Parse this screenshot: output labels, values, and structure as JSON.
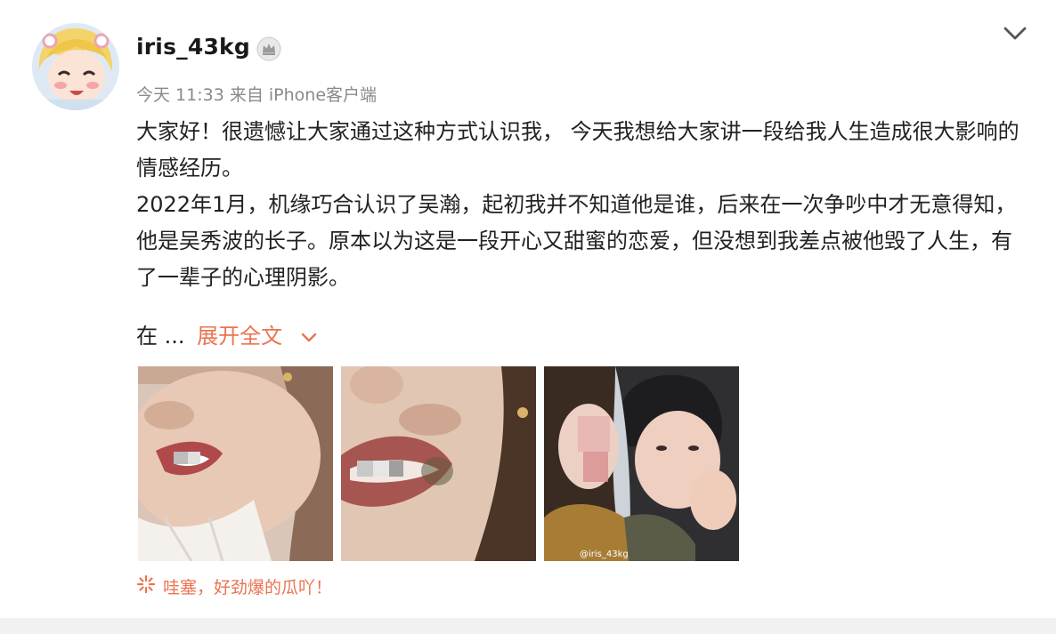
{
  "user": {
    "username": "iris_43kg",
    "meta": "今天 11:33 来自 iPhone客户端"
  },
  "post": {
    "paragraphs": [
      "大家好！很遗憾让大家通过这种方式认识我， 今天我想给大家讲一段给我人生造成很大影响的情感经历。",
      "2022年1月，机缘巧合认识了吴瀚，起初我并不知道他是谁，后来在一次争吵中才无意得知，他是吴秀波的长子。原本以为这是一段开心又甜蜜的恋爱，但没想到我差点被他毁了人生，有了一辈子的心理阴影。"
    ],
    "truncated_start": "在 ...",
    "expand_label": "展开全文"
  },
  "photos": {
    "watermark": "@iris_43kg"
  },
  "footer": {
    "note": "哇塞，好劲爆的瓜吖！"
  },
  "colors": {
    "accent": "#eb7350",
    "meta_gray": "#8a8a8a"
  },
  "icons": {
    "vip": "crown-badge-icon",
    "menu": "chevron-down-icon",
    "footer": "sparkle-icon"
  }
}
